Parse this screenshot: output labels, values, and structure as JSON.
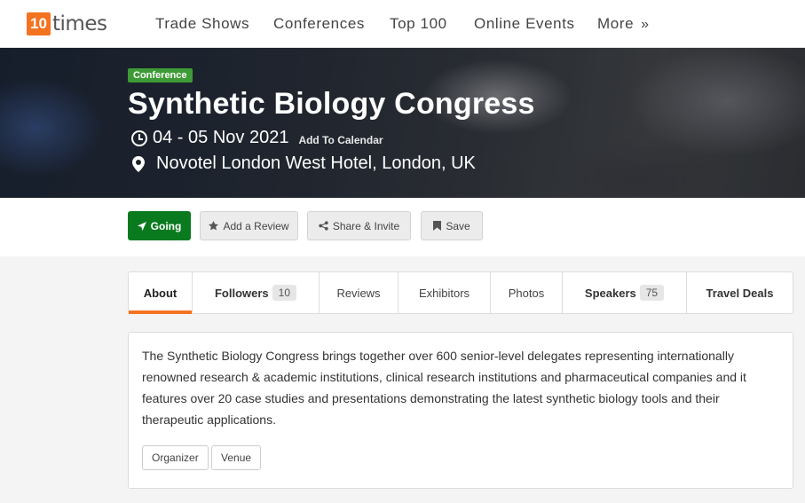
{
  "brand": {
    "logo_number": "10",
    "logo_word": "times",
    "accent": "#f47321"
  },
  "nav": {
    "items": [
      "Trade Shows",
      "Conferences",
      "Top 100",
      "Online Events"
    ],
    "more_label": "More",
    "more_icon": "double-chevron-right-icon"
  },
  "event": {
    "type_badge": "Conference",
    "title": "Synthetic Biology Congress",
    "date": "04 - 05 Nov 2021",
    "add_to_calendar": "Add To Calendar",
    "venue": "Novotel London West Hotel, London, UK"
  },
  "actions": {
    "going": "Going",
    "add_review": "Add a Review",
    "share": "Share & Invite",
    "save": "Save",
    "going_color": "#0a7a1f"
  },
  "tabs": [
    {
      "label": "About"
    },
    {
      "label": "Followers",
      "count": "10"
    },
    {
      "label": "Reviews"
    },
    {
      "label": "Exhibitors"
    },
    {
      "label": "Photos"
    },
    {
      "label": "Speakers",
      "count": "75"
    },
    {
      "label": "Travel Deals"
    }
  ],
  "about": {
    "description": "The Synthetic Biology Congress brings together over 600 senior-level delegates representing internationally renowned research & academic institutions, clinical research institutions and pharmaceutical companies and it features over 20 case studies and presentations demonstrating the latest synthetic biology tools and their therapeutic applications.",
    "links": [
      "Organizer",
      "Venue"
    ]
  }
}
